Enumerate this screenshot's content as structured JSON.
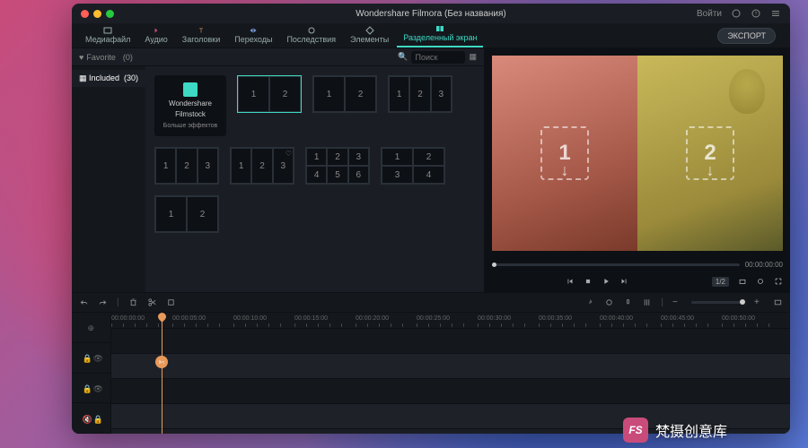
{
  "window": {
    "title": "Wondershare Filmora (Без названия)",
    "login": "Войти"
  },
  "tabs": {
    "items": [
      "Медиафайл",
      "Аудио",
      "Заголовки",
      "Переходы",
      "Последствия",
      "Элементы",
      "Разделенный экран"
    ],
    "active_index": 6,
    "export": "ЭКСПОРТ"
  },
  "filter": {
    "favorite": "Favorite",
    "fav_count": "(0)",
    "search_placeholder": "Поиск"
  },
  "sidebar": {
    "items": [
      {
        "label": "Included",
        "count": "(30)"
      }
    ]
  },
  "filmstock": {
    "line1": "Wondershare",
    "line2": "Filmstock",
    "more": "Больше эффектов"
  },
  "splits": [
    {
      "cells": [
        "1",
        "2"
      ],
      "cols": 2,
      "rows": 1,
      "selected": true
    },
    {
      "cells": [
        "1",
        "2"
      ],
      "cols": 2,
      "rows": 1
    },
    {
      "cells": [
        "1",
        "2",
        "3"
      ],
      "cols": 3,
      "rows": 1
    },
    {
      "cells": [
        "1",
        "2",
        "3"
      ],
      "cols": 3,
      "rows": 1
    },
    {
      "cells": [
        "1",
        "2",
        "3"
      ],
      "cols": 3,
      "rows": 1,
      "heart": true
    },
    {
      "cells": [
        "1",
        "2",
        "3",
        "4",
        "5",
        "6"
      ],
      "cols": 3,
      "rows": 2
    },
    {
      "cells": [
        "1",
        "2",
        "3",
        "4"
      ],
      "cols": 2,
      "rows": 2
    },
    {
      "cells": [
        "1",
        "2"
      ],
      "cols": 2,
      "rows": 1
    }
  ],
  "preview": {
    "drop1": "1",
    "drop2": "2",
    "timecode": "00:00:00:00"
  },
  "controls": {
    "zoom": "1/2"
  },
  "ruler": [
    "00:00:00:00",
    "00:00:05:00",
    "00:00:10:00",
    "00:00:15:00",
    "00:00:20:00",
    "00:00:25:00",
    "00:00:30:00",
    "00:00:35:00",
    "00:00:40:00",
    "00:00:45:00",
    "00:00:50:00"
  ],
  "watermark": {
    "badge": "FS",
    "text": "梵摄创意库"
  }
}
